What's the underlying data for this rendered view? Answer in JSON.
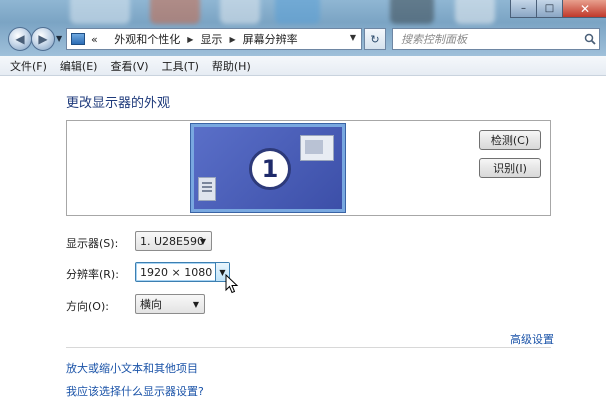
{
  "window": {
    "controls": {
      "min": "–",
      "max": "□",
      "close": "✕"
    }
  },
  "nav": {
    "back_icon": "back-arrow-icon",
    "forward_icon": "forward-arrow-icon",
    "breadcrumb": [
      "«",
      "外观和个性化",
      "显示",
      "屏幕分辨率"
    ],
    "search_placeholder": "搜索控制面板"
  },
  "menu": [
    "文件(F)",
    "编辑(E)",
    "查看(V)",
    "工具(T)",
    "帮助(H)"
  ],
  "page": {
    "title": "更改显示器的外观",
    "monitor_number": "1",
    "detect_button": "检测(C)",
    "identify_button": "识别(I)"
  },
  "settings": {
    "display_label": "显示器(S):",
    "display_value": "1. U28E590",
    "resolution_label": "分辨率(R):",
    "resolution_value": "1920 × 1080",
    "orientation_label": "方向(O):",
    "orientation_value": "横向"
  },
  "links": {
    "advanced": "高级设置",
    "text_size": "放大或缩小文本和其他项目",
    "which_settings": "我应该选择什么显示器设置?"
  }
}
